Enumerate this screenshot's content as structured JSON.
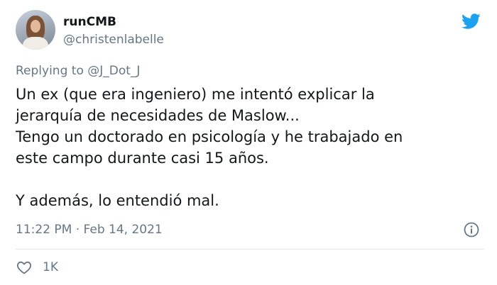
{
  "author": {
    "display_name": "runCMB",
    "handle": "@christenlabelle",
    "avatar": "avatar-photo"
  },
  "reply": {
    "prefix": "Replying to ",
    "mention": "@J_Dot_J"
  },
  "tweet": {
    "lines": [
      "Un ex (que era ingeniero) me intentó explicar la",
      "jerarquía de necesidades de Maslow...",
      "Tengo un doctorado en psicología y he trabajado en",
      "este campo durante casi 15 años."
    ],
    "closing": "Y además, lo entendió mal."
  },
  "meta": {
    "timestamp": "11:22 PM · Feb 14, 2021"
  },
  "actions": {
    "like_count": "1K"
  },
  "icons": {
    "brand": "twitter-bird-icon",
    "info": "info-icon",
    "like": "heart-icon"
  },
  "colors": {
    "brand": "#1da1f2",
    "text": "#14171a",
    "secondary": "#657786",
    "divider": "#e1e8ed"
  }
}
